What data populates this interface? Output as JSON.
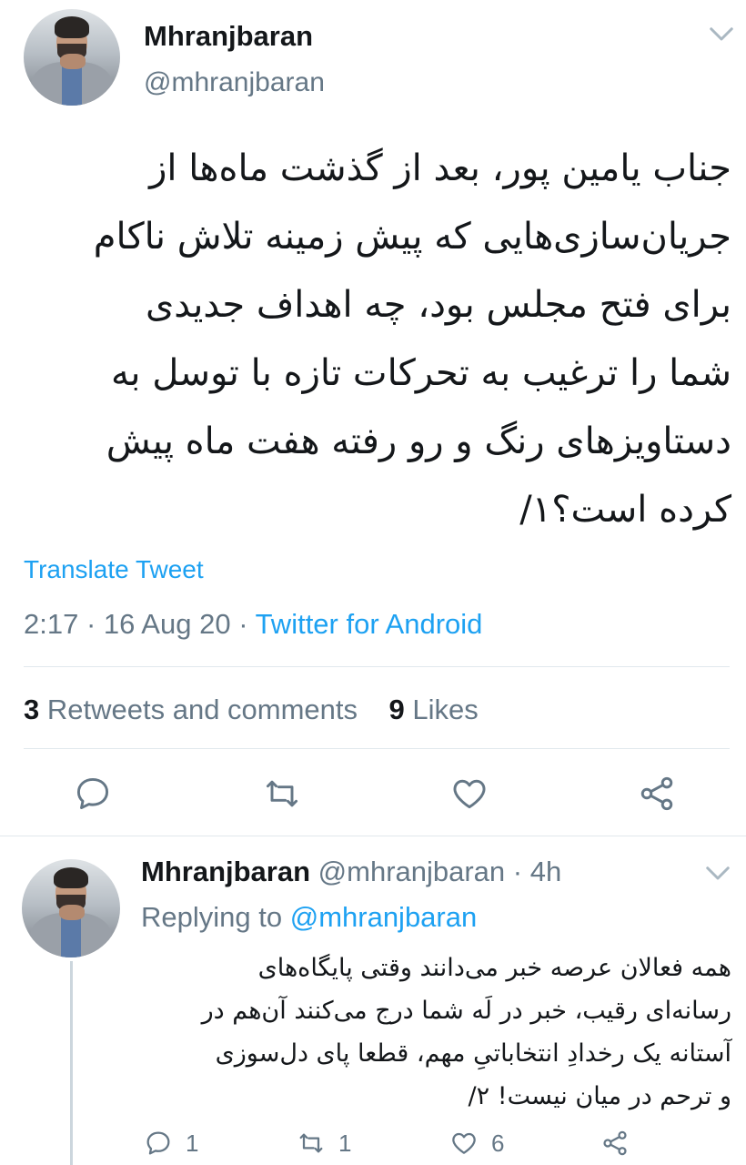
{
  "tweet": {
    "author_name": "Mhranjbaran",
    "author_handle": "@mhranjbaran",
    "text_lines": [
      "جناب یامین پور، بعد از گذشت ماه‌ها از",
      "جریان‌سازی‌هایی که پیش زمینه تلاش ناکام",
      "برای فتح مجلس بود، چه اهداف جدیدی",
      "شما را ترغیب به تحرکات تازه با توسل به",
      "دستاویزهای رنگ و رو رفته هفت ماه پیش",
      "کرده است؟۱/"
    ],
    "translate_label": "Translate Tweet",
    "time": "2:17",
    "date": "16 Aug 20",
    "separator": "·",
    "source": "Twitter for Android",
    "retweets_count": "3",
    "retweets_label": "Retweets and comments",
    "likes_count": "9",
    "likes_label": "Likes"
  },
  "icons": {
    "more": "chevron-down-icon",
    "reply": "comment-icon",
    "retweet": "retweet-icon",
    "like": "heart-icon",
    "share": "share-icon"
  },
  "reply": {
    "author_name": "Mhranjbaran",
    "author_handle": "@mhranjbaran",
    "separator": "·",
    "age": "4h",
    "replying_prefix": "Replying to",
    "replying_to": "@mhranjbaran",
    "text_lines": [
      "همه فعالان عرصه خبر می‌دانند وقتی پایگاه‌های",
      "رسانه‌ای رقیب، خبر در لَه شما درج می‌کنند آن‌هم در",
      "آستانه یک رخدادِ انتخاباتیِ مهم، قطعا پای دل‌سوزی",
      "و ترحم در میان نیست! ۲/"
    ],
    "reply_count": "1",
    "retweet_count": "1",
    "like_count": "6"
  },
  "colors": {
    "accent": "#1da1f2",
    "secondary_text": "#657786",
    "divider": "#e1e8ed"
  }
}
